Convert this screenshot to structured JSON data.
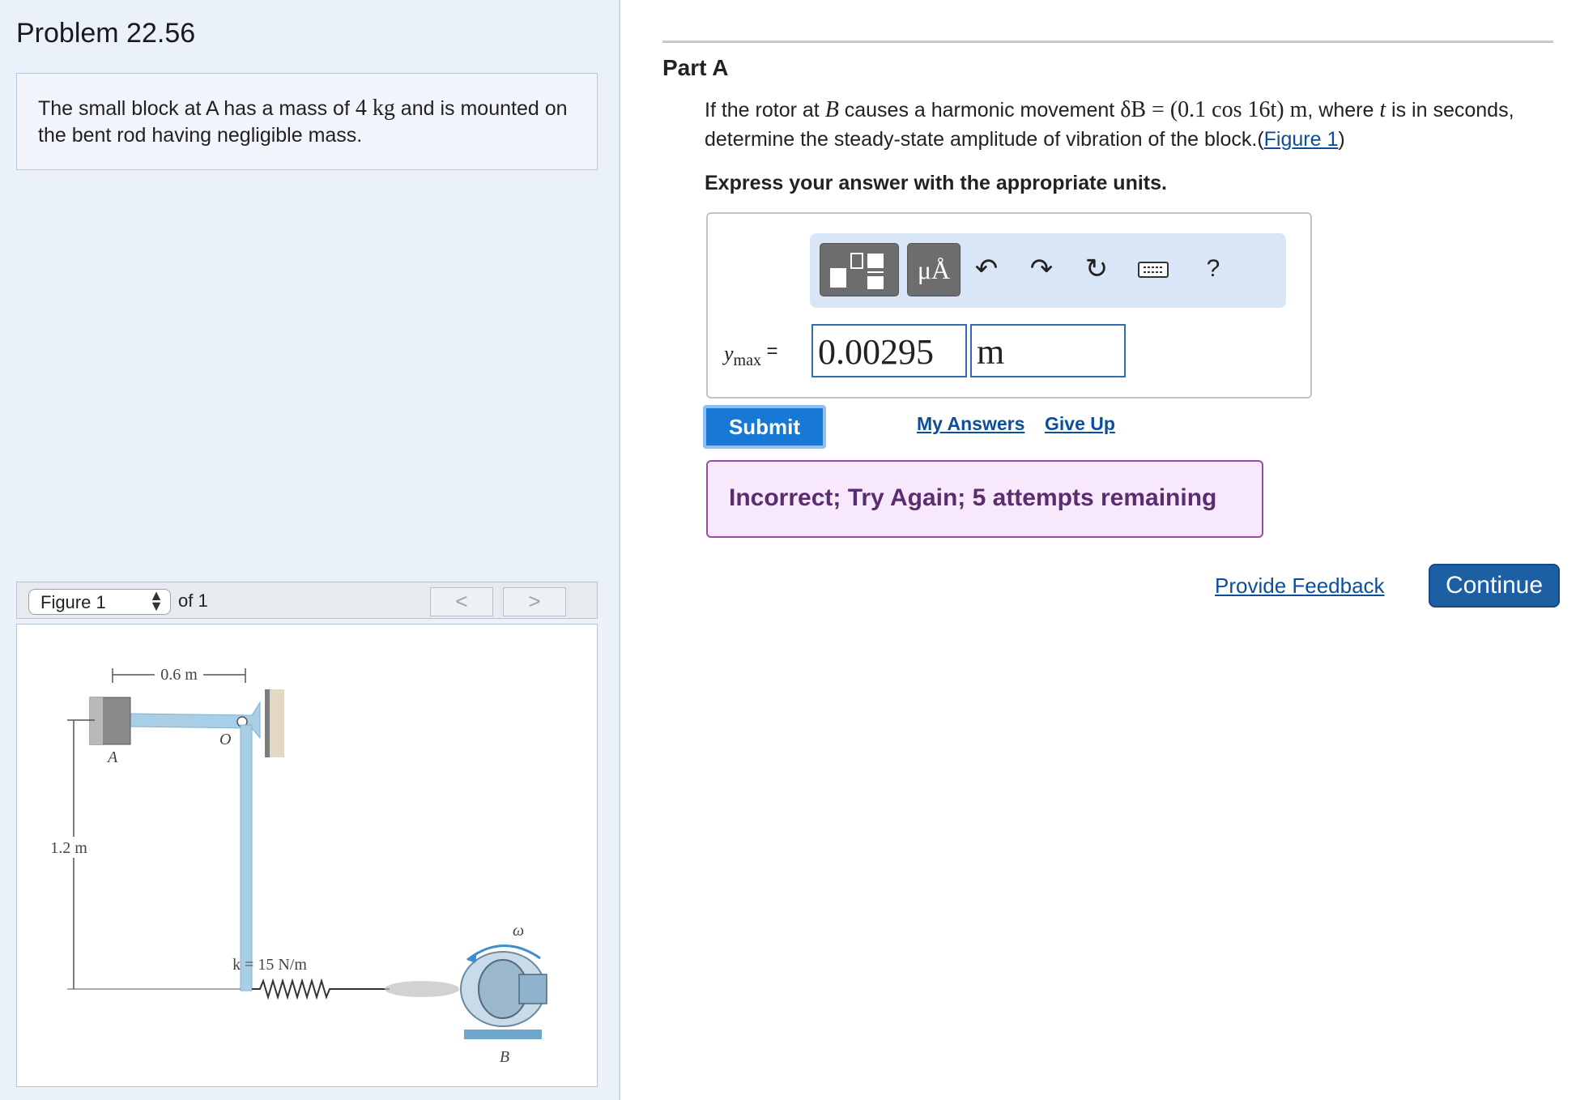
{
  "problem": {
    "title": "Problem 22.56",
    "intro_pre": "The small block at A has a mass of ",
    "intro_mass": "4 kg",
    "intro_post": " and is mounted on the bent rod having negligible mass."
  },
  "figure_nav": {
    "select_value": "Figure 1",
    "of_label": "of 1",
    "prev": "<",
    "next": ">"
  },
  "figure": {
    "dim_horizontal": "0.6 m",
    "dim_vertical": "1.2 m",
    "label_A": "A",
    "label_O": "O",
    "label_B": "B",
    "spring_label": "k = 15 N/m",
    "omega_label": "ω"
  },
  "part": {
    "title": "Part A",
    "question_1": "If the rotor at ",
    "question_B": "B",
    "question_2": " causes a harmonic movement ",
    "question_eq": "δB = (0.1 cos 16t) m",
    "question_3": ", where ",
    "question_t": "t",
    "question_4": " is in seconds, determine the steady-state amplitude of vibration of the block.(",
    "figure_link": "Figure 1",
    "question_5": ")",
    "express": "Express your answer with the appropriate units."
  },
  "answer": {
    "var_main": "y",
    "var_sub": "max",
    "equals": "=",
    "value": "0.00295",
    "unit": "m"
  },
  "toolbar": {
    "units_label": "μÅ",
    "help_label": "?"
  },
  "actions": {
    "submit": "Submit",
    "my_answers": "My Answers",
    "give_up": "Give Up"
  },
  "feedback": {
    "message": "Incorrect; Try Again; 5 attempts remaining"
  },
  "footer": {
    "provide_feedback": "Provide Feedback",
    "continue": "Continue"
  },
  "colors": {
    "left_pane_bg": "#eaf1fb",
    "submit_bg": "#1878d6",
    "feedback_border": "#9b4aa6",
    "continue_bg": "#1d5fa3",
    "link": "#0b4f9c"
  }
}
